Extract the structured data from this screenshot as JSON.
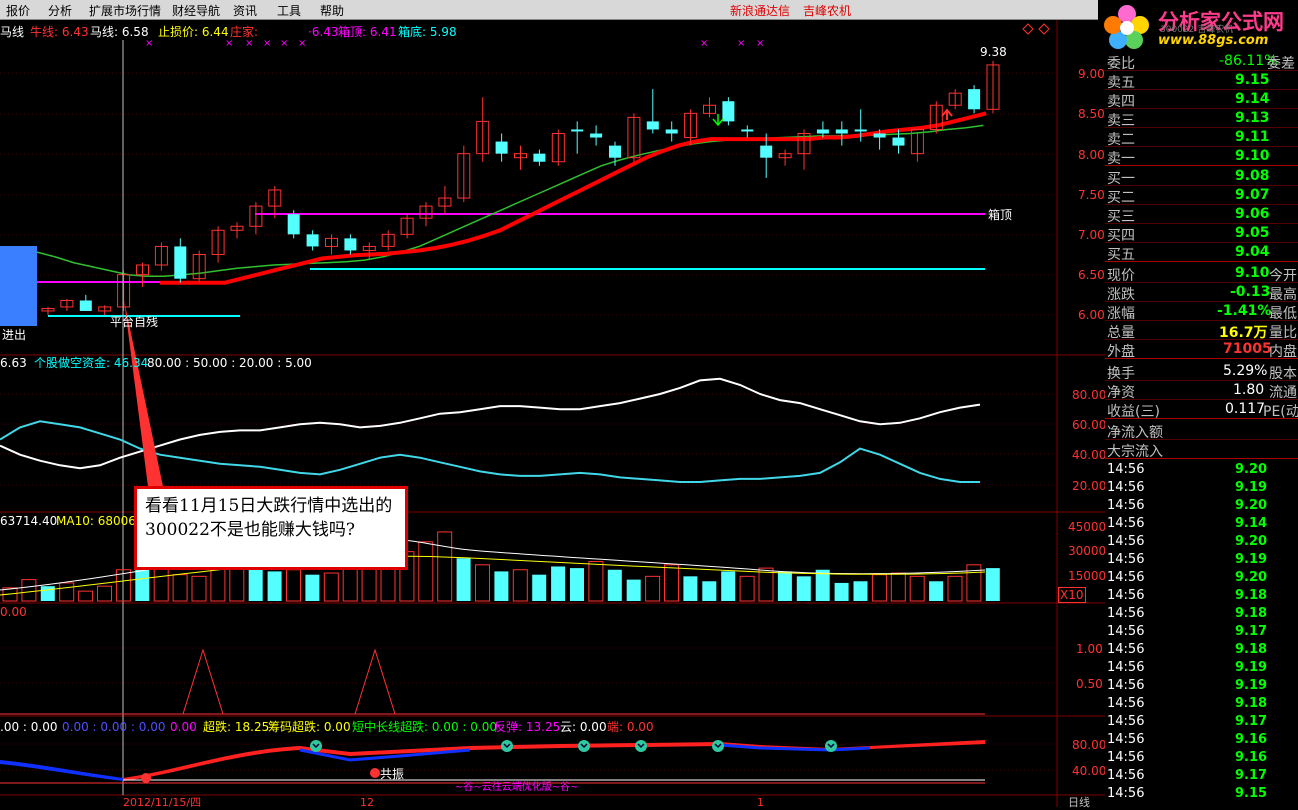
{
  "menu": {
    "items": [
      "报价",
      "分析",
      "扩展市场行情",
      "财经导航",
      "资讯",
      "工具",
      "帮助"
    ],
    "center": [
      "新浪通达信",
      "吉峰农机"
    ]
  },
  "logo": {
    "text": "分析家公式网",
    "url": "www.88gs.com",
    "sub": "300022 吉峰农机"
  },
  "top_legend": {
    "ma_name": "马线",
    "niu_label": "牛线: 6.43",
    "ma_label": "马线: 6.58",
    "stop_label": "止损价: 6.44",
    "zhuang_label": "庄家:",
    "zhuang_val": "·6.43",
    "boxtop_label": "箱顶: 6.41",
    "boxbot_label": "箱底: 5.98"
  },
  "price_axis": [
    "9.00",
    "8.50",
    "8.00",
    "7.50",
    "7.00",
    "6.50",
    "6.00"
  ],
  "annot": {
    "box_top": "箱顶",
    "price_high": "9.38",
    "enter": "进出",
    "bottom_text": "平台自残"
  },
  "ind1": {
    "label": "6.63",
    "name": "个股做空资金: 46.34",
    "vals": "80.00 : 50.00 : 20.00 : 5.00",
    "axis": [
      "80.00",
      "60.00",
      "40.00",
      "20.00"
    ]
  },
  "vol": {
    "label": "63714.40",
    "ma10": "MA10: 68006.5",
    "axis": [
      "45000",
      "30000",
      "15000"
    ],
    "unit": "X10"
  },
  "ind3": {
    "label": "0.00",
    "axis": [
      "1.00",
      "0.50"
    ]
  },
  "ind4": {
    "pre": ".00 : 0.00",
    "v1": "0.00 : 0.00 : 0.00",
    "v2": "0.00",
    "chao": "超跌: 18.25",
    "chou": "筹码超跌: 0.00",
    "duan": "短中长线超跌: 0.00 : 0.00",
    "fan": "反弹: 13.25",
    "yun": "云: 0.00",
    "duan2": "端: 0.00",
    "axis": [
      "80.00",
      "40.00"
    ],
    "gongzhen": "共振",
    "footer": "~谷~云往云端优化版~谷~"
  },
  "date_axis": {
    "left": "2012/11/15/四",
    "mid": "12",
    "right": "1",
    "cycle": "日线"
  },
  "callout": {
    "text": "看看11月15日大跌行情中选出的300022不是也能赚大钱吗?"
  },
  "right_panel": {
    "weibi": {
      "label": "委比",
      "value": "-86.11%",
      "tail": "委差"
    },
    "sells": [
      {
        "label": "卖五",
        "price": "9.15"
      },
      {
        "label": "卖四",
        "price": "9.14"
      },
      {
        "label": "卖三",
        "price": "9.13"
      },
      {
        "label": "卖二",
        "price": "9.11"
      },
      {
        "label": "卖一",
        "price": "9.10"
      }
    ],
    "buys": [
      {
        "label": "买一",
        "price": "9.08"
      },
      {
        "label": "买二",
        "price": "9.07"
      },
      {
        "label": "买三",
        "price": "9.06"
      },
      {
        "label": "买四",
        "price": "9.05"
      },
      {
        "label": "买五",
        "price": "9.04"
      }
    ],
    "stats1": [
      {
        "label": "现价",
        "value": "9.10",
        "tail": "今开"
      },
      {
        "label": "涨跌",
        "value": "-0.13",
        "tail": "最高"
      },
      {
        "label": "涨幅",
        "value": "-1.41%",
        "tail": "最低"
      },
      {
        "label": "总量",
        "value": "16.7万",
        "tail": "量比"
      },
      {
        "label": "外盘",
        "value": "71005",
        "tail": "内盘"
      }
    ],
    "stats2": [
      {
        "label": "换手",
        "value": "5.29%",
        "tail": "股本"
      },
      {
        "label": "净资",
        "value": "1.80",
        "tail": "流通"
      },
      {
        "label": "收益(三)",
        "value": "0.117",
        "tail": "PE(动"
      }
    ],
    "flow": [
      "净流入额",
      "大宗流入"
    ],
    "ticks": [
      {
        "t": "14:56",
        "p": "9.20"
      },
      {
        "t": "14:56",
        "p": "9.19"
      },
      {
        "t": "14:56",
        "p": "9.20"
      },
      {
        "t": "14:56",
        "p": "9.14"
      },
      {
        "t": "14:56",
        "p": "9.20"
      },
      {
        "t": "14:56",
        "p": "9.19"
      },
      {
        "t": "14:56",
        "p": "9.20"
      },
      {
        "t": "14:56",
        "p": "9.18"
      },
      {
        "t": "14:56",
        "p": "9.18"
      },
      {
        "t": "14:56",
        "p": "9.17"
      },
      {
        "t": "14:56",
        "p": "9.18"
      },
      {
        "t": "14:56",
        "p": "9.19"
      },
      {
        "t": "14:56",
        "p": "9.19"
      },
      {
        "t": "14:56",
        "p": "9.18"
      },
      {
        "t": "14:56",
        "p": "9.17"
      },
      {
        "t": "14:56",
        "p": "9.16"
      },
      {
        "t": "14:56",
        "p": "9.16"
      },
      {
        "t": "14:56",
        "p": "9.17"
      },
      {
        "t": "14:56",
        "p": "9.15"
      }
    ]
  },
  "colors": {
    "up": "#ff3232",
    "down": "#54ffff",
    "ma5": "#ffffff",
    "ma_red": "#ff0000",
    "ma_green": "#00c000",
    "box": "#ff00ff",
    "cyan": "#00ffff",
    "yellow": "#ffff00",
    "green": "#00ff00",
    "grid": "#800000"
  },
  "chart_data": {
    "type": "candlestick",
    "candles": [
      [
        6.05,
        6.1,
        6.0,
        6.08,
        0
      ],
      [
        6.1,
        6.2,
        6.05,
        6.18,
        0
      ],
      [
        6.18,
        6.25,
        6.1,
        6.05,
        1
      ],
      [
        6.05,
        6.12,
        6.0,
        6.1,
        0
      ],
      [
        6.1,
        6.55,
        6.05,
        6.5,
        0
      ],
      [
        6.5,
        6.65,
        6.35,
        6.62,
        0
      ],
      [
        6.62,
        6.9,
        6.55,
        6.85,
        0
      ],
      [
        6.85,
        6.95,
        6.4,
        6.45,
        1
      ],
      [
        6.45,
        6.8,
        6.4,
        6.75,
        0
      ],
      [
        6.75,
        7.1,
        6.65,
        7.05,
        0
      ],
      [
        7.05,
        7.15,
        6.95,
        7.1,
        0
      ],
      [
        7.1,
        7.4,
        7.0,
        7.35,
        0
      ],
      [
        7.35,
        7.6,
        7.2,
        7.55,
        0
      ],
      [
        7.25,
        7.3,
        6.95,
        7.0,
        1
      ],
      [
        7.0,
        7.05,
        6.8,
        6.85,
        1
      ],
      [
        6.85,
        7.0,
        6.75,
        6.95,
        0
      ],
      [
        6.95,
        7.0,
        6.75,
        6.8,
        1
      ],
      [
        6.8,
        6.9,
        6.7,
        6.85,
        0
      ],
      [
        6.85,
        7.05,
        6.8,
        7.0,
        0
      ],
      [
        7.0,
        7.25,
        6.95,
        7.2,
        0
      ],
      [
        7.2,
        7.4,
        7.1,
        7.35,
        0
      ],
      [
        7.35,
        7.6,
        7.25,
        7.45,
        0
      ],
      [
        7.45,
        8.1,
        7.4,
        8.0,
        0
      ],
      [
        8.0,
        8.7,
        7.9,
        8.4,
        0
      ],
      [
        8.15,
        8.25,
        7.9,
        8.0,
        1
      ],
      [
        8.0,
        8.1,
        7.8,
        7.95,
        0
      ],
      [
        8.0,
        8.05,
        7.85,
        7.9,
        1
      ],
      [
        7.9,
        8.3,
        7.85,
        8.25,
        0
      ],
      [
        8.3,
        8.4,
        8.0,
        8.3,
        1
      ],
      [
        8.25,
        8.35,
        8.1,
        8.2,
        1
      ],
      [
        8.1,
        8.15,
        7.85,
        7.95,
        1
      ],
      [
        7.95,
        8.5,
        7.9,
        8.45,
        0
      ],
      [
        8.4,
        8.8,
        8.25,
        8.3,
        1
      ],
      [
        8.3,
        8.4,
        8.15,
        8.25,
        1
      ],
      [
        8.2,
        8.55,
        8.1,
        8.5,
        0
      ],
      [
        8.5,
        8.7,
        8.45,
        8.6,
        0
      ],
      [
        8.65,
        8.7,
        8.35,
        8.4,
        1
      ],
      [
        8.3,
        8.35,
        8.2,
        8.3,
        1
      ],
      [
        8.1,
        8.25,
        7.7,
        7.95,
        1
      ],
      [
        7.95,
        8.05,
        7.85,
        8.0,
        0
      ],
      [
        8.0,
        8.3,
        7.8,
        8.25,
        0
      ],
      [
        8.3,
        8.4,
        8.2,
        8.25,
        1
      ],
      [
        8.25,
        8.4,
        8.1,
        8.3,
        1
      ],
      [
        8.3,
        8.55,
        8.15,
        8.3,
        1
      ],
      [
        8.25,
        8.3,
        8.05,
        8.2,
        1
      ],
      [
        8.2,
        8.3,
        8.0,
        8.1,
        1
      ],
      [
        8.0,
        8.25,
        7.9,
        8.3,
        0
      ],
      [
        8.3,
        8.65,
        8.25,
        8.6,
        0
      ],
      [
        8.6,
        8.8,
        8.55,
        8.75,
        0
      ],
      [
        8.8,
        8.85,
        8.5,
        8.55,
        1
      ],
      [
        8.55,
        9.15,
        8.5,
        9.1,
        0
      ],
      [
        9.1,
        9.35,
        9.0,
        9.4,
        0
      ],
      [
        9.4,
        9.4,
        8.85,
        9.25,
        1
      ]
    ],
    "ma_red": [
      6.4,
      6.4,
      6.4,
      6.4,
      6.4,
      6.45,
      6.5,
      6.55,
      6.6,
      6.65,
      6.7,
      6.72,
      6.74,
      6.75,
      6.76,
      6.78,
      6.8,
      6.83,
      6.87,
      6.92,
      6.98,
      7.05,
      7.15,
      7.25,
      7.35,
      7.45,
      7.55,
      7.65,
      7.75,
      7.85,
      7.95,
      8.03,
      8.1,
      8.15,
      8.18,
      8.18,
      8.18,
      8.18,
      8.18,
      8.18,
      8.18,
      8.2,
      8.2,
      8.22,
      8.25,
      8.28,
      8.3,
      8.32,
      8.35,
      8.4,
      8.45,
      8.5
    ],
    "ma_green": [
      6.78,
      6.72,
      6.65,
      6.6,
      6.55,
      6.5,
      6.48,
      6.48,
      6.5,
      6.52,
      6.55,
      6.58,
      6.6,
      6.62,
      6.63,
      6.64,
      6.65,
      6.66,
      6.68,
      6.72,
      6.78,
      6.85,
      6.95,
      7.05,
      7.15,
      7.25,
      7.35,
      7.45,
      7.55,
      7.65,
      7.75,
      7.85,
      7.92,
      7.98,
      8.03,
      8.08,
      8.12,
      8.15,
      8.17,
      8.18,
      8.19,
      8.2,
      8.21,
      8.22,
      8.22,
      8.23,
      8.23,
      8.24,
      8.25,
      8.27,
      8.3,
      8.32,
      8.35
    ],
    "ind1_white": [
      46,
      40,
      36,
      33,
      31,
      33,
      38,
      42,
      46,
      50,
      53,
      55,
      56,
      56,
      58,
      60,
      61,
      60,
      58,
      59,
      61,
      64,
      67,
      68,
      70,
      72,
      72,
      71,
      70,
      70,
      72,
      74,
      77,
      80,
      84,
      89,
      90,
      86,
      80,
      76,
      74,
      70,
      66,
      62,
      60,
      61,
      64,
      68,
      71,
      73
    ],
    "ind1_cyan": [
      50,
      58,
      62,
      60,
      58,
      54,
      50,
      44,
      40,
      38,
      36,
      34,
      33,
      32,
      30,
      28,
      27,
      30,
      34,
      38,
      40,
      38,
      35,
      32,
      29,
      27,
      26,
      26,
      27,
      28,
      27,
      25,
      24,
      23,
      22,
      22,
      23,
      24,
      24,
      25,
      26,
      28,
      35,
      44,
      40,
      34,
      28,
      24,
      22,
      22
    ],
    "volume": [
      8000,
      13000,
      9000,
      11000,
      6000,
      9000,
      19000,
      20000,
      20000,
      16000,
      15000,
      21000,
      26000,
      22000,
      18000,
      19000,
      16000,
      17000,
      20000,
      23000,
      26000,
      30000,
      36000,
      42000,
      26000,
      22000,
      18000,
      19000,
      16000,
      21000,
      20000,
      24000,
      19000,
      13000,
      15000,
      22000,
      15000,
      12000,
      18000,
      15000,
      20000,
      18000,
      15000,
      19000,
      11000,
      12000,
      16000,
      17000,
      15000,
      12000,
      15000,
      22000,
      20000,
      17000
    ]
  }
}
